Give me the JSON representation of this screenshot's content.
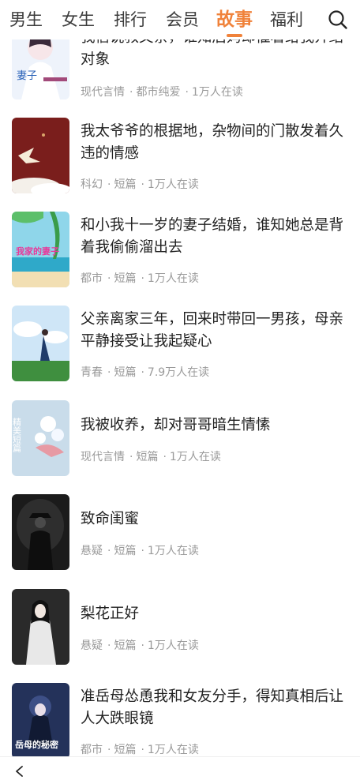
{
  "nav": {
    "tabs": [
      {
        "label": "男生"
      },
      {
        "label": "女生"
      },
      {
        "label": "排行"
      },
      {
        "label": "会员"
      },
      {
        "label": "故事"
      },
      {
        "label": "福利"
      }
    ],
    "active_tab": "故事",
    "accent_color": "#f0823a"
  },
  "items": [
    {
      "title": "我信说救又亲，谁知后妈却催着给我介绍对象",
      "category": "现代言情",
      "tag": "都市纯爱",
      "reads": "1万人在读",
      "cover_text": "妻子"
    },
    {
      "title": "我太爷爷的根据地，杂物间的门散发着久违的情感",
      "category": "科幻",
      "tag": "短篇",
      "reads": "1万人在读",
      "cover_text": ""
    },
    {
      "title": "和小我十一岁的妻子结婚，谁知她总是背着我偷偷溜出去",
      "category": "都市",
      "tag": "短篇",
      "reads": "1万人在读",
      "cover_text": "我家的妻子"
    },
    {
      "title": "父亲离家三年，回来时带回一男孩，母亲平静接受让我起疑心",
      "category": "青春",
      "tag": "短篇",
      "reads": "7.9万人在读",
      "cover_text": ""
    },
    {
      "title": "我被收养，却对哥哥暗生情愫",
      "category": "现代言情",
      "tag": "短篇",
      "reads": "1万人在读",
      "cover_text": "精美短篇"
    },
    {
      "title": "致命闺蜜",
      "category": "悬疑",
      "tag": "短篇",
      "reads": "1万人在读",
      "cover_text": ""
    },
    {
      "title": "梨花正好",
      "category": "悬疑",
      "tag": "短篇",
      "reads": "1万人在读",
      "cover_text": ""
    },
    {
      "title": "准岳母怂恿我和女友分手，得知真相后让人大跌眼镜",
      "category": "都市",
      "tag": "短篇",
      "reads": "1万人在读",
      "cover_text": "岳母的秘密"
    }
  ]
}
